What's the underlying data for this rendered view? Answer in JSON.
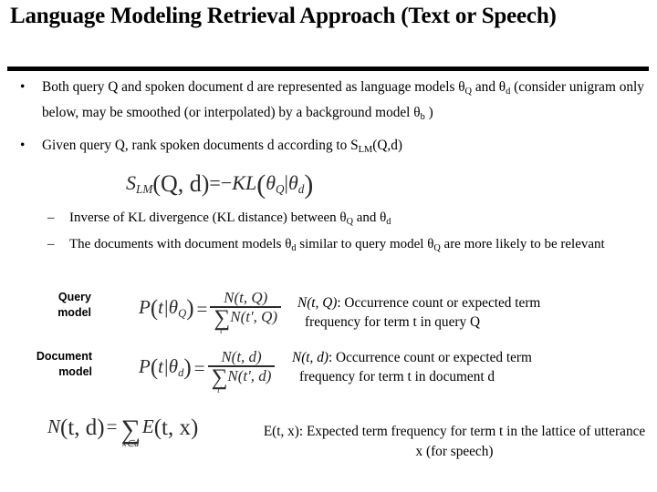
{
  "slide": {
    "title": "Language Modeling Retrieval Approach (Text or Speech)",
    "bullets": [
      {
        "marker": "•",
        "segments": [
          "Both query Q and spoken document d are represented as  language models θ",
          "Q",
          " and θ",
          "d",
          " (consider unigram only below, may be smoothed (or interpolated) by a background model θ",
          "b",
          " )"
        ],
        "text": "Both query Q and spoken document d are represented as  language models θQ and θd (consider unigram only below, may be smoothed (or interpolated) by a background model θb )"
      },
      {
        "marker": "•",
        "pre": "Given query Q, rank spoken documents d according to S",
        "sub": "LM",
        "post": "(Q,d)"
      }
    ],
    "slm_formula": {
      "lhs_symbol": "S",
      "lhs_sub": "LM",
      "lhs_args": "(Q, d)",
      "equals": "=",
      "minus": "−",
      "kl": "KL",
      "open": "(",
      "theta_q": "θ",
      "theta_q_sub": "Q",
      "divider": "|",
      "theta_d": "θ",
      "theta_d_sub": "d",
      "close": ")"
    },
    "sub_bullets": [
      {
        "marker": "–",
        "pre": "Inverse of KL divergence (KL distance) between θ",
        "sub1": "Q",
        "mid": " and θ",
        "sub2": "d",
        "post": ""
      },
      {
        "marker": "–",
        "pre": "The documents with document models θ",
        "sub1": "d",
        "mid": " similar to query model θ",
        "sub2": "Q",
        "post": " are more likely to be relevant"
      }
    ],
    "model_rows": [
      {
        "label_line1": "Query",
        "label_line2": "model",
        "formula": {
          "p": "P",
          "open": "(",
          "t": "t",
          "bar": "|",
          "theta": "θ",
          "theta_sub": "Q",
          "close": ")",
          "equals": "=",
          "numerator_n": "N",
          "numerator_args": "(t, Q)",
          "sum": "∑",
          "sum_index": "t'",
          "denominator_n": "N",
          "denominator_args": "(t', Q)"
        },
        "explain_math": "N(t, Q)",
        "explain_line1": ": Occurrence count or expected term",
        "explain_line2": "frequency for term t in query Q"
      },
      {
        "label_line1": "Document",
        "label_line2": "model",
        "formula": {
          "p": "P",
          "open": "(",
          "t": "t",
          "bar": "|",
          "theta": "θ",
          "theta_sub": "d",
          "close": ")",
          "equals": "=",
          "numerator_n": "N",
          "numerator_args": "(t, d)",
          "sum": "∑",
          "sum_index": "t'",
          "denominator_n": "N",
          "denominator_args": "(t', d)"
        },
        "explain_math": "N(t, d)",
        "explain_line1": ": Occurrence count or expected term",
        "explain_line2": "frequency for term t in document d"
      }
    ],
    "bottom_formula": {
      "n": "N",
      "args": "(t, d)",
      "equals": "=",
      "sum": "∑",
      "sum_index": "x∈d",
      "e": "E",
      "e_args": "(t, x)"
    },
    "bottom_explain_line1": "E(t, x): Expected term frequency for term t in the",
    "bottom_explain_line2": "lattice of utterance x (for speech)"
  },
  "colors": {
    "background": "#ffffff",
    "text": "#000000",
    "formula_text": "#2b2b2b",
    "rule": "#000000"
  }
}
